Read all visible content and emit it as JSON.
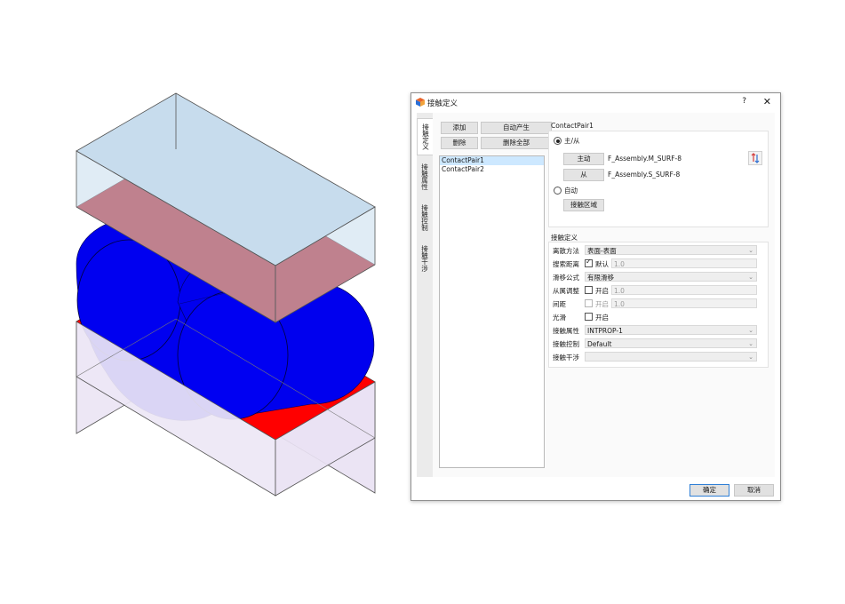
{
  "dialog": {
    "title": "接触定义",
    "help": "?",
    "close": "✕",
    "ok_label": "确定",
    "cancel_label": "取消"
  },
  "tabs": [
    {
      "label": "接触定义",
      "active": true
    },
    {
      "label": "接触属性",
      "active": false
    },
    {
      "label": "接触控制",
      "active": false
    },
    {
      "label": "接触干涉",
      "active": false
    }
  ],
  "toolbar": {
    "add_label": "添加",
    "auto_label": "自动产生",
    "delete_label": "删除",
    "delete_all_label": "删除全部"
  },
  "pairs": [
    "ContactPair1",
    "ContactPair2"
  ],
  "selected_pair": "ContactPair1",
  "pair": {
    "name": "ContactPair1",
    "mode_master_slave_label": "主/从",
    "mode_master_slave_selected": true,
    "master_button": "主动",
    "master_surface": "F_Assembly.M_SURF-8",
    "slave_button": "从",
    "slave_surface": "F_Assembly.S_SURF-8",
    "mode_auto_label": "自动",
    "mode_auto_selected": false,
    "contact_region_button": "接触区域"
  },
  "definition": {
    "group_title": "接触定义",
    "discretization": {
      "label": "离散方法",
      "value": "表面-表面"
    },
    "search_distance": {
      "label": "搜索距离",
      "check_label": "默认",
      "checked": true,
      "value": "1.0"
    },
    "sliding": {
      "label": "滑移公式",
      "value": "有限滑移"
    },
    "slave_adjust": {
      "label": "从属调整",
      "check_label": "开启",
      "checked": false,
      "value": "1.0"
    },
    "clearance": {
      "label": "间距",
      "check_label": "开启",
      "checked": false,
      "value": "1.0"
    },
    "smooth": {
      "label": "光滑",
      "check_label": "开启",
      "checked": false
    },
    "property": {
      "label": "接触属性",
      "value": "INTPROP-1"
    },
    "control": {
      "label": "接触控制",
      "value": "Default"
    },
    "interference": {
      "label": "接触干涉",
      "value": ""
    }
  },
  "colors": {
    "box_top": "#c7dced",
    "box_bottom": "#e5dff0",
    "surface_master": "#b5121b",
    "surface_slave": "#ff0000",
    "cylinder": "#0000ee",
    "dialog_border": "#8f8f8f",
    "ok_border": "#2f7fd6"
  },
  "icons": {
    "title_icon": "app-logo-icon",
    "swap_icon": "swap-arrows-icon",
    "dropdown_icon": "chevron-down-icon"
  }
}
